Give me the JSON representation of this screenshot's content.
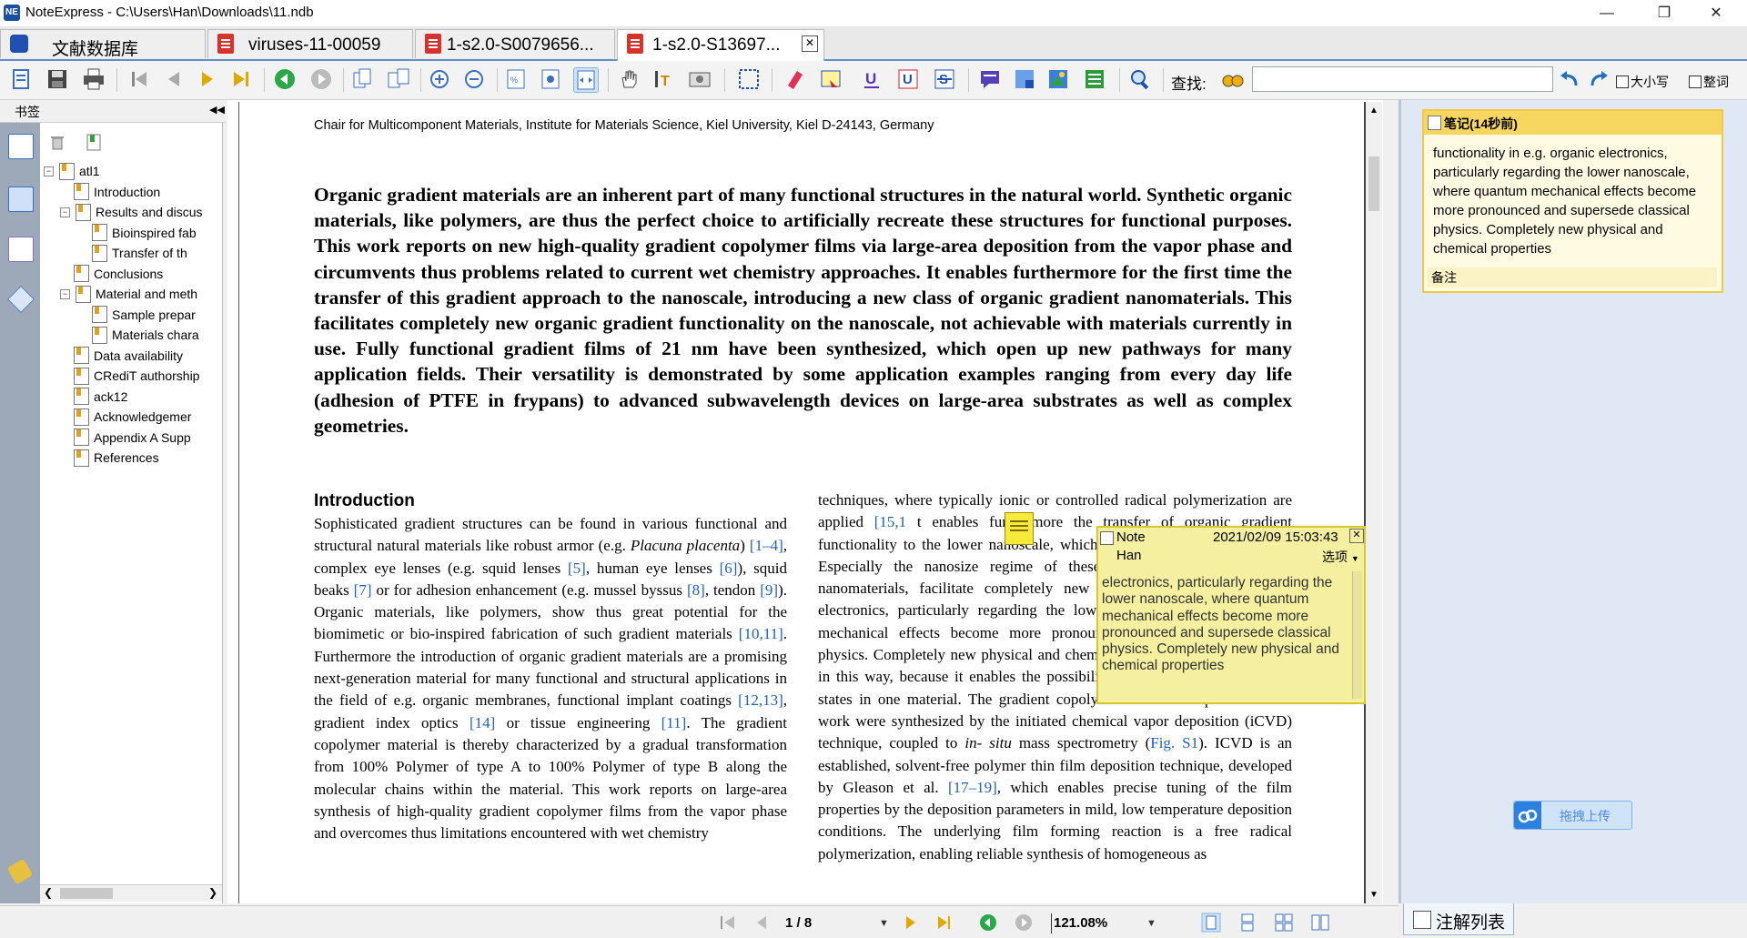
{
  "window": {
    "title": "NoteExpress - C:\\Users\\Han\\Downloads\\11.ndb",
    "app_icon_text": "NE"
  },
  "tabs": [
    {
      "label": "文献数据库",
      "active": false
    },
    {
      "label": "viruses-11-00059",
      "active": false
    },
    {
      "label": "1-s2.0-S0079656...",
      "active": false
    },
    {
      "label": "1-s2.0-S13697...",
      "active": true
    }
  ],
  "toolbar": {
    "search_label": "查找:",
    "search_value": "",
    "match_case_label": "大小写",
    "whole_word_label": "整词"
  },
  "sidebar": {
    "header": "书签",
    "tree": [
      {
        "label": "atl1",
        "level": 0,
        "expander": "−"
      },
      {
        "label": "Introduction",
        "level": 1
      },
      {
        "label": "Results and discus",
        "level": 1,
        "expander": "−"
      },
      {
        "label": "Bioinspired fab",
        "level": 2
      },
      {
        "label": "Transfer of th",
        "level": 2
      },
      {
        "label": "Conclusions",
        "level": 1
      },
      {
        "label": "Material and meth",
        "level": 1,
        "expander": "−"
      },
      {
        "label": "Sample prepar",
        "level": 2
      },
      {
        "label": "Materials chara",
        "level": 2
      },
      {
        "label": "Data availability",
        "level": 1
      },
      {
        "label": "CRediT authorship",
        "level": 1
      },
      {
        "label": "ack12",
        "level": 1
      },
      {
        "label": "Acknowledgemer",
        "level": 1
      },
      {
        "label": "Appendix A Supp",
        "level": 1
      },
      {
        "label": "References",
        "level": 1
      }
    ]
  },
  "document": {
    "affiliation": "Chair for Multicomponent Materials, Institute for Materials Science, Kiel University, Kiel D-24143, Germany",
    "abstract": "Organic gradient materials are an inherent part of many functional structures in the natural world. Synthetic organic materials, like polymers, are thus the perfect choice to artificially recreate these structures for functional purposes. This work reports on new high-quality gradient copolymer films via large-area deposition from the vapor phase and circumvents thus problems related to current wet chemistry approaches. It enables furthermore for the first time the transfer of this gradient approach to the nanoscale, introducing a new class of organic gradient nanomaterials. This facilitates completely new organic gradient functionality on the nanoscale, not achievable with materials currently in use. Fully functional gradient films of 21 nm have been synthesized, which open up new pathways for many application fields. Their versatility is demonstrated by some application examples ranging from every day life (adhesion of PTFE in frypans) to advanced subwavelength devices on large-area substrates as well as complex geometries.",
    "intro_heading": "Introduction",
    "left_column": [
      {
        "t": "Sophisticated gradient structures can be found in various functional and structural natural materials like robust armor (e.g. "
      },
      {
        "t": "Placuna placenta",
        "i": true
      },
      {
        "t": ") "
      },
      {
        "t": "[1–4]",
        "c": true
      },
      {
        "t": ", complex eye lenses (e.g. squid lenses "
      },
      {
        "t": "[5]",
        "c": true
      },
      {
        "t": ", human eye lenses "
      },
      {
        "t": "[6]",
        "c": true
      },
      {
        "t": "), squid beaks "
      },
      {
        "t": "[7]",
        "c": true
      },
      {
        "t": " or for adhesion enhancement (e.g. mussel byssus "
      },
      {
        "t": "[8]",
        "c": true
      },
      {
        "t": ", tendon "
      },
      {
        "t": "[9]",
        "c": true
      },
      {
        "t": "). Organic materials, like polymers, show thus great potential for the biomimetic or bio-inspired fabrication of such gradient materials "
      },
      {
        "t": "[10,11]",
        "c": true
      },
      {
        "t": ". Furthermore the introduction of organic gradient materials are a promising next-generation material for many functional and structural applications in the field of e.g. organic membranes, functional implant coatings "
      },
      {
        "t": "[12,13]",
        "c": true
      },
      {
        "t": ", gradient index optics "
      },
      {
        "t": "[14]",
        "c": true
      },
      {
        "t": " or tissue engineering "
      },
      {
        "t": "[11]",
        "c": true
      },
      {
        "t": ". The gradient copolymer material is thereby characterized by a gradual transformation from 100% Polymer of type A to 100% Polymer of type B along the molecular chains within the material. This work reports on large-area synthesis of high-quality gradient copolymer films from the vapor phase and overcomes thus limitations encountered with wet chemistry"
      }
    ],
    "right_column": [
      {
        "t": "techniques, where typically ionic or controlled radical polymerization are applied "
      },
      {
        "t": "[15,1",
        "c": true
      },
      {
        "t": "     t enables furthermore the transfer of organic gradient functionality to the lower nanoscale, which has so far not been reported. Especially the nanosize regime of these materials, organic gradient nanomaterials, facilitate completely new functionality in e.g. organic electronics, particularly regarding the lower nanoscale, where quantum mechanical effects become more pronounced and supersede classical physics. Completely new physical and chemical properties can be obtained in this way, because it enables the possibility to incorporate two material states in one material. The gradient copolymer materials reported in this work were synthesized by the initiated chemical vapor deposition (iCVD) technique, coupled to "
      },
      {
        "t": "in- situ",
        "i": true
      },
      {
        "t": " mass spectrometry ("
      },
      {
        "t": "Fig. S1",
        "c": true
      },
      {
        "t": "). ICVD is an established, solvent-free polymer thin film deposition technique, developed by Gleason et al. "
      },
      {
        "t": "[17–19]",
        "c": true
      },
      {
        "t": ", which enables precise tuning of the film properties by the deposition parameters in mild, low temperature deposition conditions. The underlying film forming reaction is a free radical polymerization, enabling reliable synthesis of homogeneous as"
      }
    ]
  },
  "note_popup": {
    "title": "Note",
    "timestamp": "2021/02/09 15:03:43",
    "author": "Han",
    "options_label": "选项",
    "text": "electronics, particularly regarding the lower nanoscale, where quantum mechanical effects become more pronounced and supersede classical physics. Completely new physical and chemical properties"
  },
  "right_panel": {
    "note_card_title": "笔记(14秒前)",
    "note_card_text": "functionality in e.g. organic electronics, particularly regarding the lower nanoscale, where quantum mechanical effects become more pronounced and supersede classical physics. Completely new physical and chemical properties",
    "remark_label": "备注",
    "upload_label": "拖拽上传",
    "annotation_tab": "注解列表"
  },
  "bottombar": {
    "page_indicator": "1 / 8",
    "zoom": "121.08%"
  },
  "colors": {
    "accent_blue": "#2060c0",
    "note_yellow": "#f5f0a0",
    "pdf_red": "#d9312b",
    "sidebar_strip": "#9da9b8",
    "right_panel_bg": "#e1e8f5"
  }
}
